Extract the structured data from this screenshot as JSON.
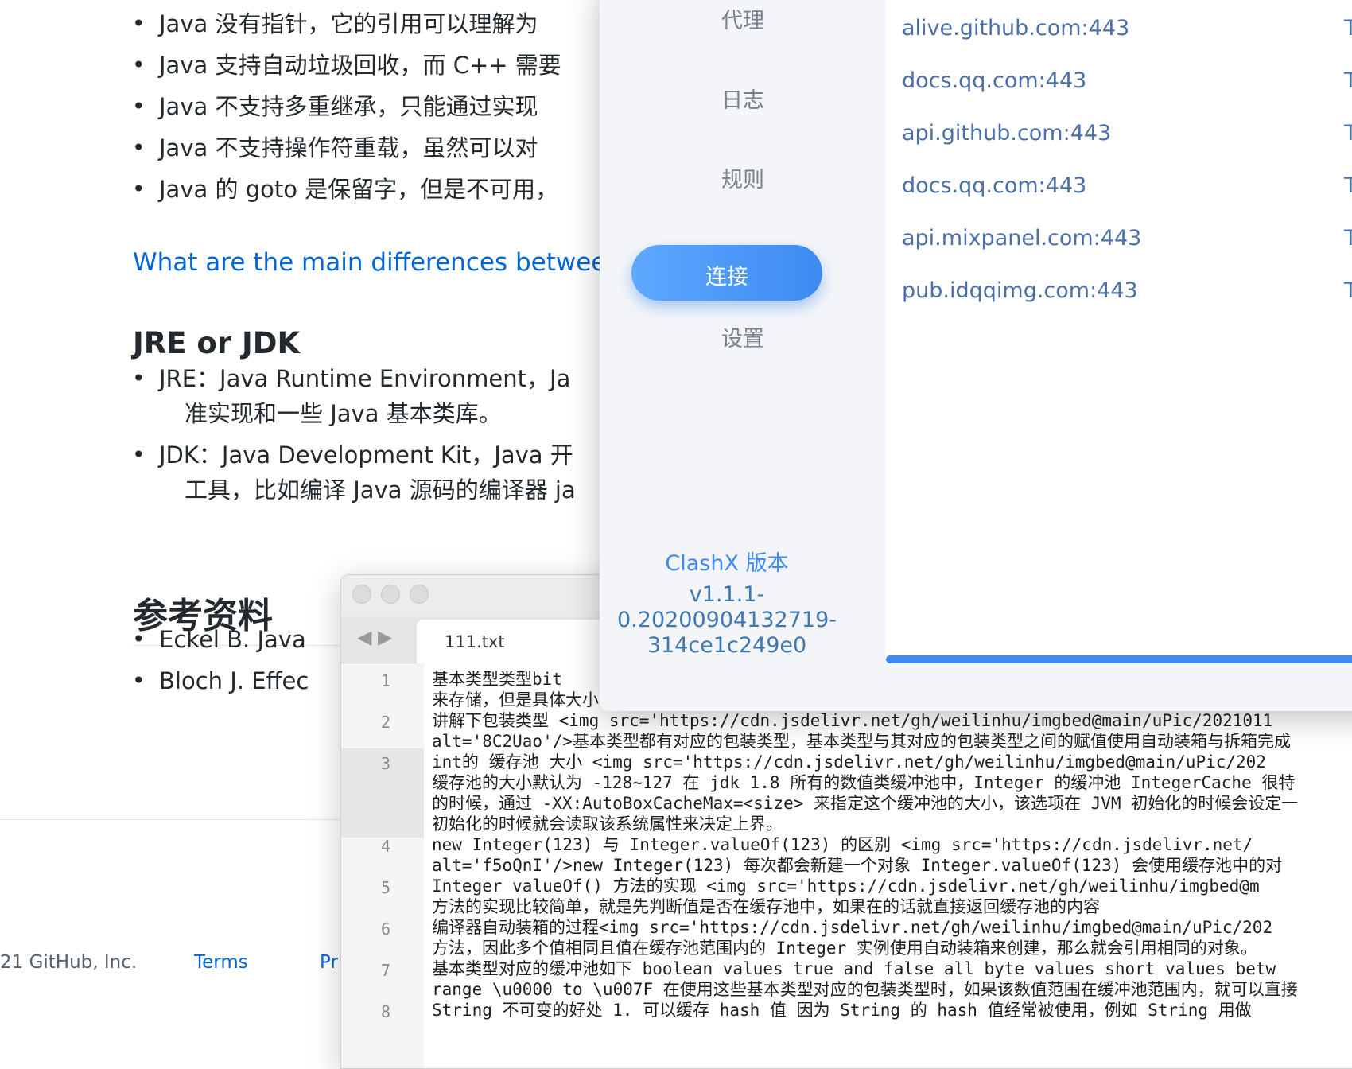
{
  "background_page": {
    "bullets_top": [
      "Java 没有指针，它的引用可以理解为",
      "Java 支持自动垃圾回收，而 C++ 需要",
      "Java 不支持多重继承，只能通过实现",
      "Java 不支持操作符重载，虽然可以对",
      "Java 的 goto 是保留字，但是不可用，"
    ],
    "link_text": "What are the main differences between J",
    "heading_jre": "JRE or JDK",
    "jre_line1": "JRE：Java Runtime Environment，Ja",
    "jre_line2": "准实现和一些 Java 基本类库。",
    "jdk_line1": "JDK：Java Development Kit，Java 开",
    "jdk_line2": "工具，比如编译 Java 源码的编译器 ja",
    "heading_refs": "参考资料",
    "refs": [
      "Eckel B. Java",
      "Bloch J. Effec"
    ],
    "footer": {
      "copyright": "21 GitHub, Inc.",
      "terms": "Terms",
      "privacy": "Pr"
    }
  },
  "editor": {
    "tab_name": "111.txt",
    "nav_back": "◀",
    "nav_forward": "▶",
    "line_numbers": [
      "1",
      "2",
      "3",
      "4",
      "5",
      "6",
      "7",
      "8"
    ],
    "lines": [
      "基本类型类型bit",
      "来存储，但是具体大小",
      "讲解下包装类型 <img src='https://cdn.jsdelivr.net/gh/weilinhu/imgbed@main/uPic/2021011",
      "alt='8C2Uao'/>基本类型都有对应的包装类型，基本类型与其对应的包装类型之间的赋值使用自动装箱与拆箱完成",
      "int的 缓存池 大小  <img src='https://cdn.jsdelivr.net/gh/weilinhu/imgbed@main/uPic/202",
      "缓存池的大小默认为 -128~127 在 jdk 1.8 所有的数值类缓冲池中，Integer 的缓冲池 IntegerCache 很特",
      "的时候，通过 -XX:AutoBoxCacheMax=<size> 来指定这个缓冲池的大小，该选项在 JVM 初始化的时候会设定一",
      "初始化的时候就会读取该系统属性来决定上界。",
      "new Integer(123) 与 Integer.valueOf(123) 的区别   <img src='https://cdn.jsdelivr.net/",
      "alt='f5oQnI'/>new Integer(123) 每次都会新建一个对象 Integer.valueOf(123) 会使用缓存池中的对",
      "Integer valueOf() 方法的实现  <img src='https://cdn.jsdelivr.net/gh/weilinhu/imgbed@m",
      "方法的实现比较简单，就是先判断值是否在缓存池中，如果在的话就直接返回缓存池的内容",
      "编译器自动装箱的过程<img src='https://cdn.jsdelivr.net/gh/weilinhu/imgbed@main/uPic/202",
      "方法，因此多个值相同且值在缓存池范围内的 Integer 实例使用自动装箱来创建，那么就会引用相同的对象。",
      "基本类型对应的缓冲池如下 boolean values true and false all byte values short values betw",
      "range \\u0000 to \\u007F 在使用这些基本类型对应的包装类型时，如果该数值范围在缓冲池范围内，就可以直接",
      "String 不可变的好处   1. 可以缓存 hash 值  因为 String 的 hash 值经常被使用，例如 String 用做"
    ]
  },
  "clashx": {
    "menu": {
      "proxy": "代理",
      "log": "日志",
      "rules": "规则",
      "connections": "连接",
      "settings": "设置"
    },
    "version_title": "ClashX 版本",
    "version_lines": [
      "v1.1.1-",
      "0.20200904132719-",
      "314ce1c249e0"
    ],
    "connections": [
      {
        "host": "alive.github.com:443",
        "type": "T"
      },
      {
        "host": "docs.qq.com:443",
        "type": "T"
      },
      {
        "host": "api.github.com:443",
        "type": "T"
      },
      {
        "host": "docs.qq.com:443",
        "type": "T"
      },
      {
        "host": "api.mixpanel.com:443",
        "type": "T"
      },
      {
        "host": "pub.idqqimg.com:443",
        "type": "T"
      }
    ],
    "accent_color": "#3d8bf2"
  }
}
